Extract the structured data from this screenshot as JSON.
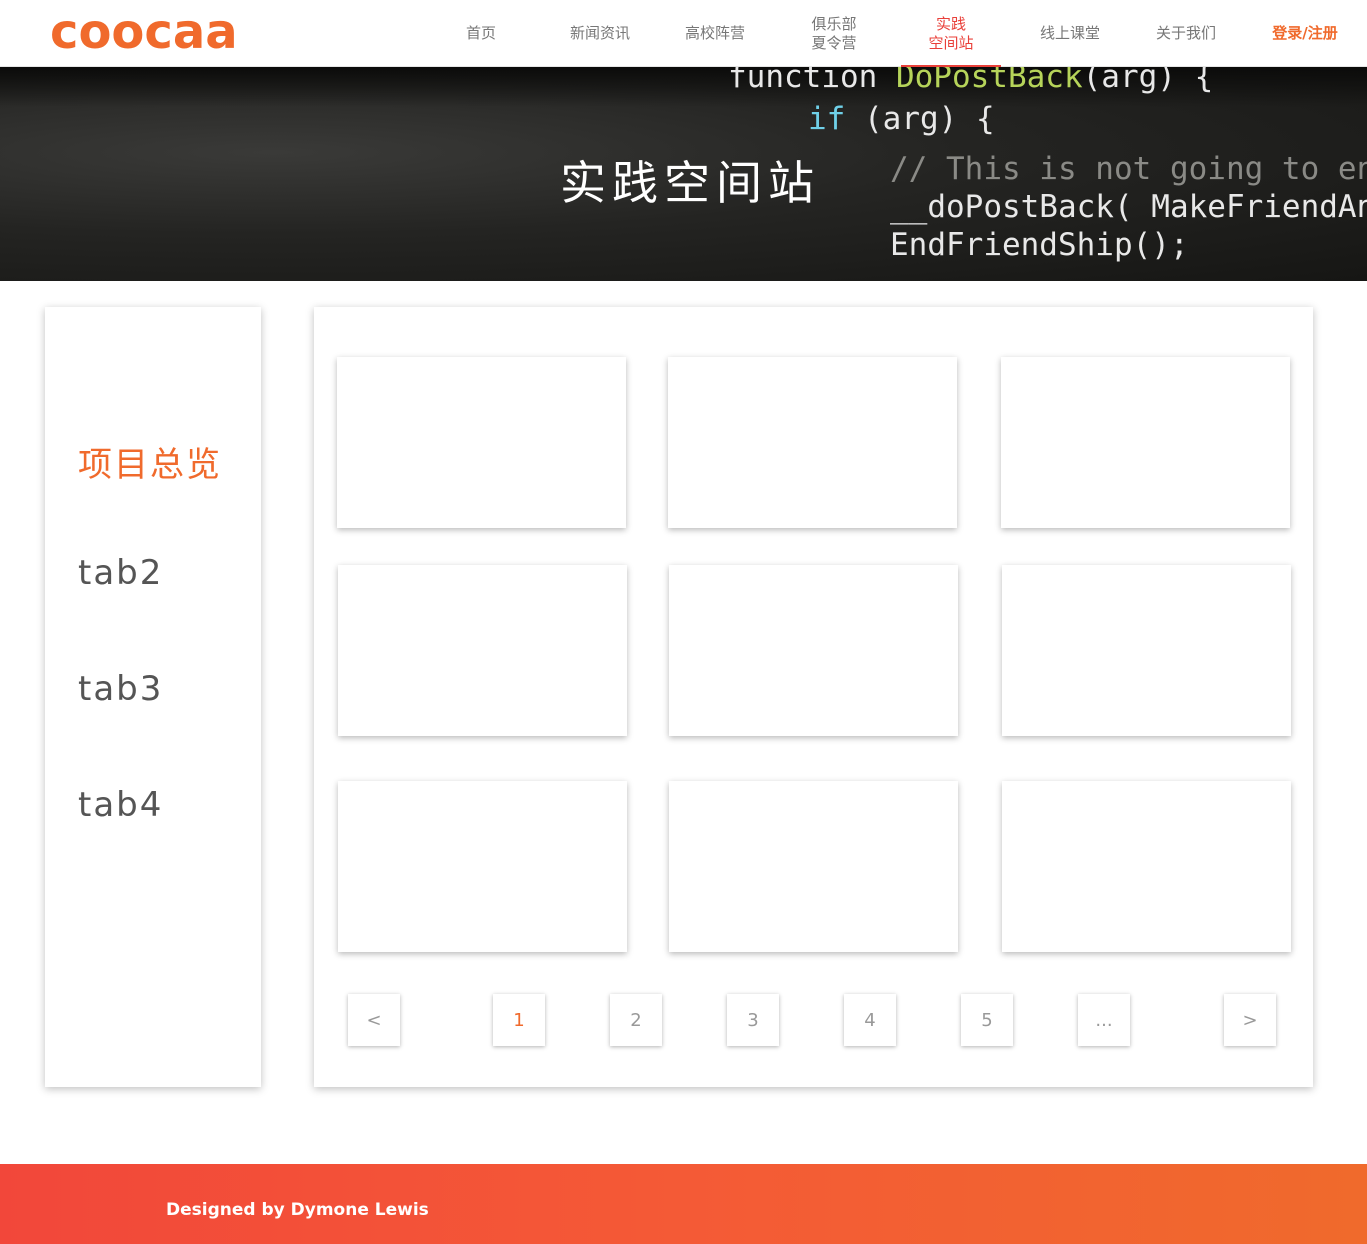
{
  "header": {
    "logo_text": "coocaa",
    "nav": [
      {
        "label": "首页"
      },
      {
        "label": "新闻资讯"
      },
      {
        "label": "高校阵营"
      },
      {
        "line1": "俱乐部",
        "line2": "夏令营"
      },
      {
        "line1": "实践",
        "line2": "空间站"
      },
      {
        "label": "线上课堂"
      },
      {
        "label": "关于我们"
      },
      {
        "label": "登录/注册"
      }
    ],
    "active_color": "#e9403a",
    "accent_color": "#f06a2c"
  },
  "banner": {
    "title": "实践空间站",
    "code": {
      "l1_a": "function ",
      "l1_fn": "DoPostBack",
      "l1_b": "(arg) {",
      "l2_kw": "if",
      "l2_b": " (arg) {",
      "l3_cm": "// This is not going to end w",
      "l4": "__doPostBack( MakeFriendAngry",
      "l5": "EndFriendShip();"
    }
  },
  "sidebar": {
    "tabs": [
      {
        "label": "项目总览"
      },
      {
        "label": "tab2"
      },
      {
        "label": "tab3"
      },
      {
        "label": "tab4"
      }
    ]
  },
  "pagination": {
    "prev": "<",
    "pages": [
      "1",
      "2",
      "3",
      "4",
      "5"
    ],
    "ellipsis": "...",
    "next": ">",
    "current": "1"
  },
  "footer": {
    "credit": "Designed by Dymone Lewis"
  }
}
